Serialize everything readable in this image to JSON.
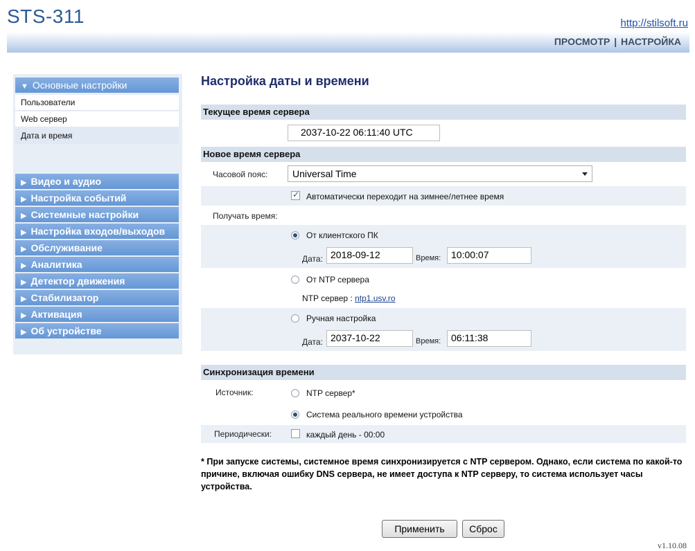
{
  "header": {
    "brand": "STS-311",
    "site_link": "http://stilsoft.ru",
    "nav_view": "ПРОСМОТР",
    "nav_sep": "|",
    "nav_settings": "НАСТРОЙКА"
  },
  "sidebar": {
    "main_section": "Основные настройки",
    "sub_items": [
      "Пользователи",
      "Web сервер",
      "Дата и время"
    ],
    "sections": [
      "Видео и аудио",
      "Настройка событий",
      "Системные настройки",
      "Настройка входов/выходов",
      "Обслуживание",
      "Аналитика",
      "Детектор движения",
      "Стабилизатор",
      "Активация",
      "Об устройстве"
    ]
  },
  "main": {
    "title": "Настройка даты и времени",
    "current_section": "Текущее время сервера",
    "current_time": "2037-10-22 06:11:40 UTC",
    "new_section": "Новое время сервера",
    "timezone_label": "Часовой пояс:",
    "timezone_value": "Universal Time",
    "dst_label": "Автоматически переходит на зимнее/летнее время",
    "get_time_label": "Получать время:",
    "from_pc_label": "От клиентского ПК",
    "date_label": "Дата:",
    "time_label": "Время:",
    "pc_date": "2018-09-12",
    "pc_time": "10:00:07",
    "from_ntp_label": "От NTP сервера",
    "ntp_server_label": "NTP сервер : ",
    "ntp_server_value": "ntp1.usv.ro",
    "manual_label": "Ручная настройка",
    "manual_date": "2037-10-22",
    "manual_time": "06:11:38",
    "sync_section": "Синхронизация времени",
    "source_label": "Источник:",
    "source_ntp": "NTP сервер*",
    "source_rtc": "Система реального времени устройства",
    "periodic_label": "Периодически:",
    "periodic_value": "каждый день - 00:00",
    "note": "* При запуске системы, системное время синхронизируется с NTP сервером. Однако, если система по какой-то причине, включая ошибку DNS сервера, не имеет доступа к NTP серверу, то система использует часы устройства.",
    "apply": "Применить",
    "reset": "Сброс",
    "version": "v1.10.08"
  }
}
